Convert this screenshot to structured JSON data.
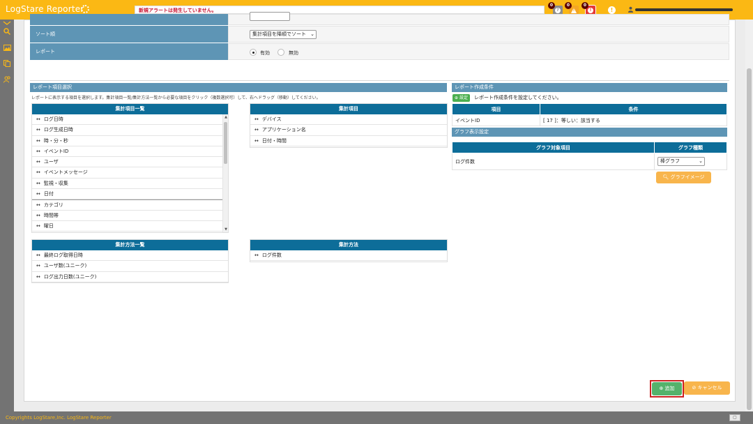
{
  "header": {
    "app_title": "LogStare Reporter",
    "alert_message": "新規アラートは発生していません。",
    "badges": [
      {
        "name": "info-badge",
        "count": "0",
        "glyph": "?",
        "color": "#888888"
      },
      {
        "name": "warning-badge",
        "count": "0",
        "glyph": "!",
        "color": "#f5a623"
      },
      {
        "name": "error-badge",
        "count": "0",
        "glyph": "!",
        "color": "#e53935"
      }
    ],
    "help_glyph": "!",
    "user_icon": "user-icon"
  },
  "sidebar": {
    "icons": [
      "expand-icon",
      "search-icon",
      "report-image-icon",
      "copy-icon",
      "users-icon"
    ]
  },
  "settings": {
    "sort_label": "ソート順",
    "sort_value": "集計項目を降順でソート",
    "report_label": "レポート",
    "report_enabled": "有効",
    "report_disabled": "無効"
  },
  "report_items": {
    "section_title": "レポート項目選択",
    "description": "レポートに表示する項目を選択します。集計項目一覧/集計方法一覧から必要な項目をクリック（複数選択可）して、右へドラッグ（移動）してください。",
    "available_title": "集計項目一覧",
    "available": [
      "ログ日時",
      "ログ生成日時",
      "時・分・秒",
      "イベントID",
      "ユーザ",
      "イベントメッセージ",
      "監視・収集",
      "日付",
      "カテゴリ",
      "時間帯",
      "曜日"
    ],
    "selected_title": "集計項目",
    "selected": [
      "デバイス",
      "アプリケーション名",
      "日付・時間"
    ],
    "methods_title": "集計方法一覧",
    "methods": [
      "最終ログ取得日時",
      "ユーザ数(ユニーク)",
      "ログ出力日数(ユニーク)"
    ],
    "selected_methods_title": "集計方法",
    "selected_methods": [
      "ログ件数"
    ]
  },
  "conditions": {
    "section_title": "レポート作成条件",
    "set_button": "設定",
    "set_hint": "レポート作成条件を設定してください。",
    "col_item": "項目",
    "col_condition": "条件",
    "rows": [
      {
        "item": "イベントID",
        "condition": "[ 17 ]：等しい：該当する"
      }
    ]
  },
  "graph": {
    "section_title": "グラフ表示設定",
    "col_target": "グラフ対象項目",
    "col_type": "グラフ種類",
    "rows": [
      {
        "target": "ログ件数",
        "type": "棒グラフ"
      }
    ],
    "image_button": "グラフイメージ"
  },
  "actions": {
    "add_label": "追加",
    "cancel_label": "キャンセル"
  },
  "footer": {
    "copyright": "Copyrights LogStare,Inc.  LogStare Reporter",
    "button_glyph": "▢"
  }
}
